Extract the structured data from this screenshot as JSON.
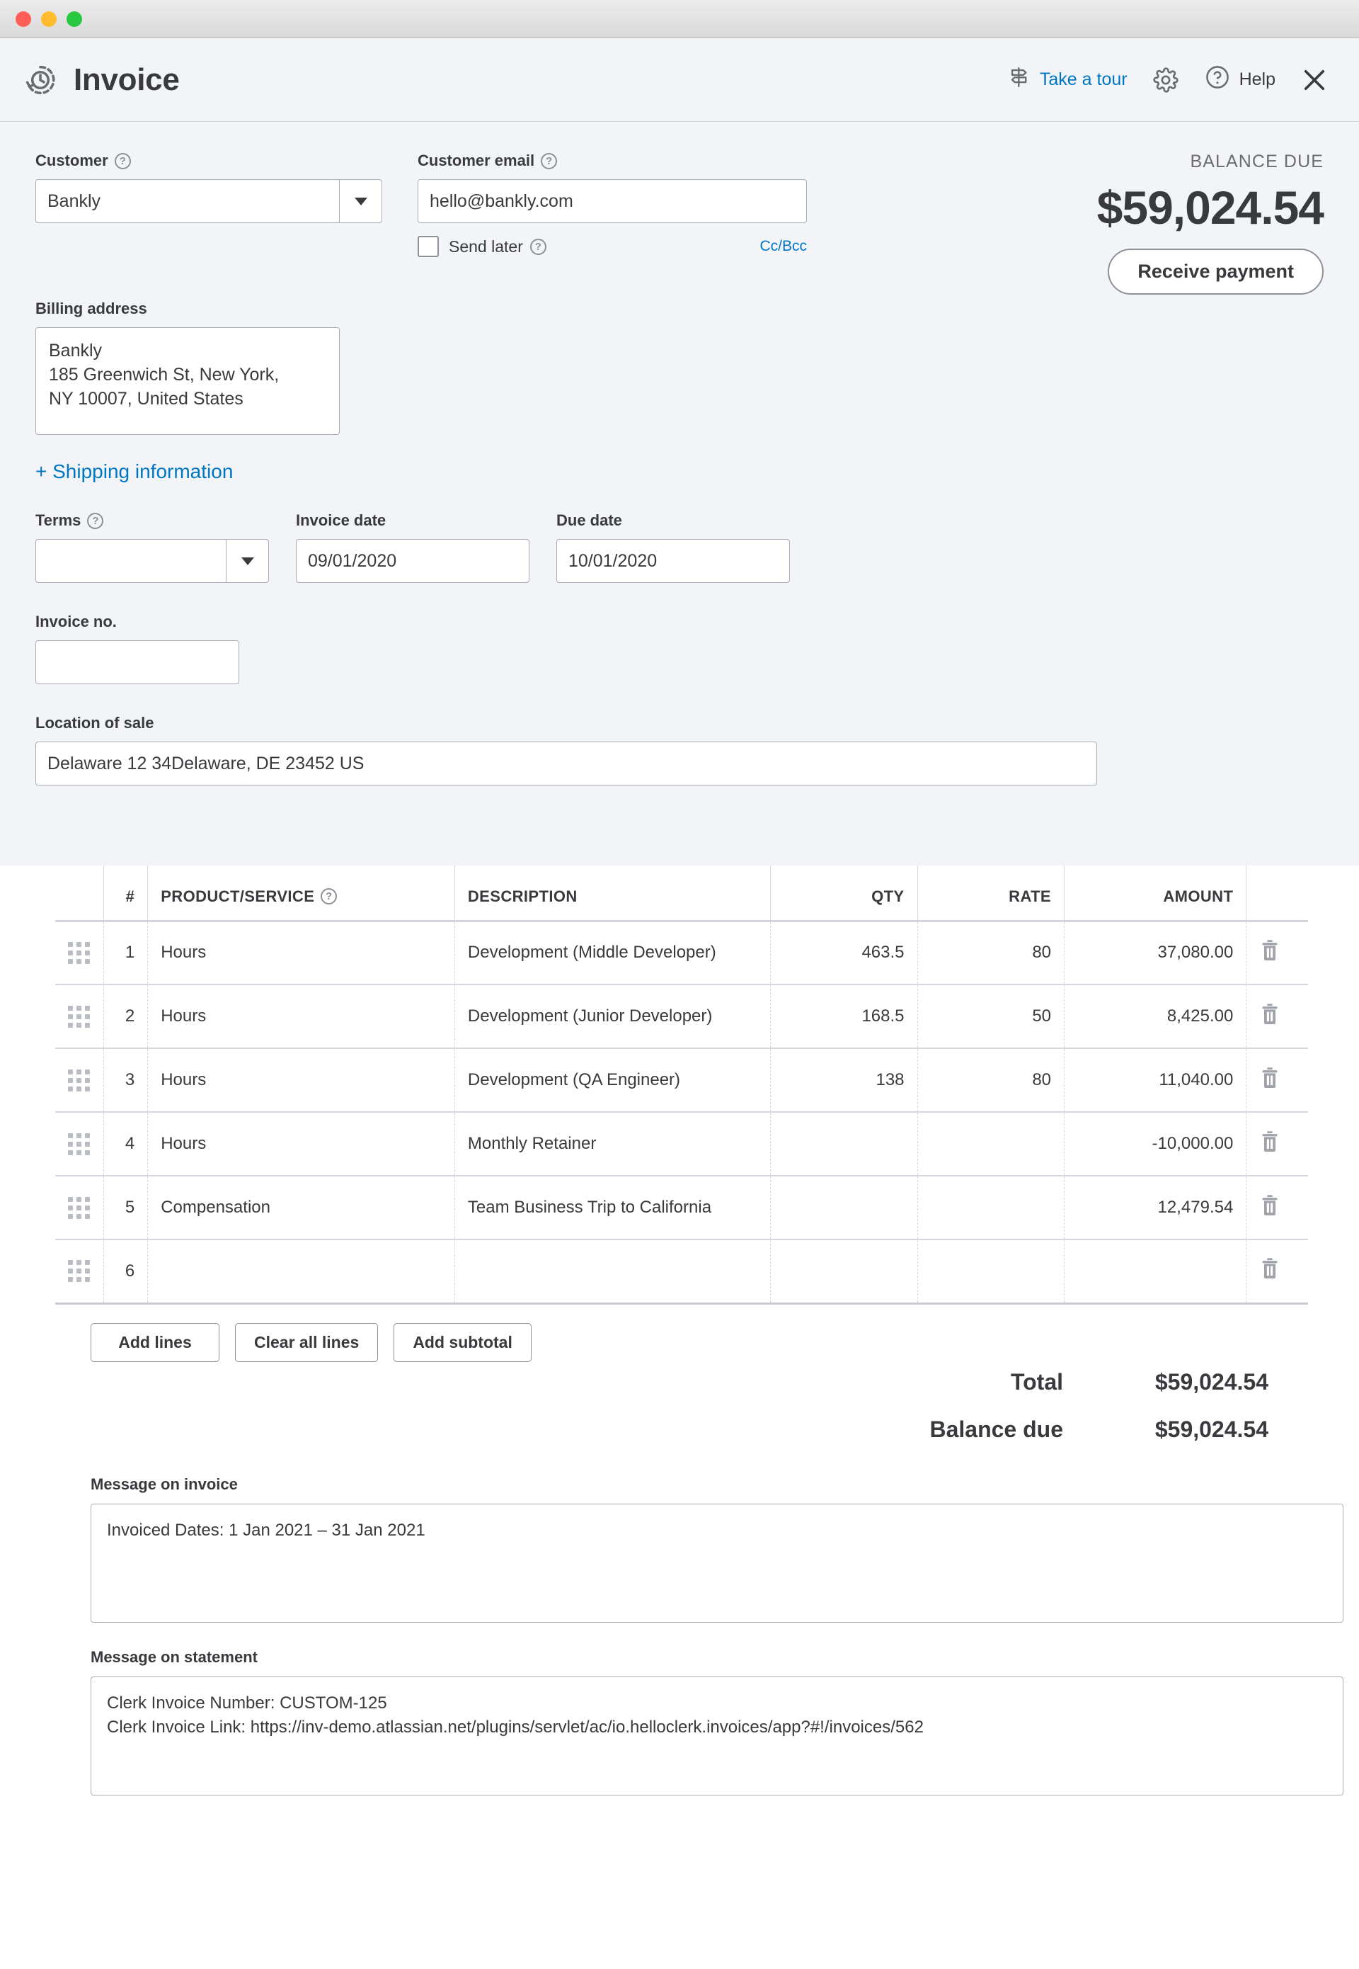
{
  "window": {
    "traffic_lights": [
      "close",
      "minimize",
      "maximize"
    ]
  },
  "header": {
    "title": "Invoice",
    "clock_icon": "history-clock-icon",
    "tour_label": "Take a tour",
    "tour_icon": "signpost-icon",
    "settings_icon": "gear-icon",
    "help_label": "Help",
    "help_icon": "question-circle-icon",
    "close_icon": "close-icon"
  },
  "form": {
    "customer_label": "Customer",
    "customer_value": "Bankly",
    "customer_email_label": "Customer email",
    "customer_email_value": "hello@bankly.com",
    "send_later_label": "Send later",
    "ccbcc_label": "Cc/Bcc",
    "billing_address_label": "Billing address",
    "billing_address_value": "Bankly\n185 Greenwich St, New York,\nNY 10007, United States",
    "shipping_link": "+ Shipping information",
    "terms_label": "Terms",
    "terms_value": "",
    "invoice_date_label": "Invoice date",
    "invoice_date_value": "09/01/2020",
    "due_date_label": "Due date",
    "due_date_value": "10/01/2020",
    "invoice_no_label": "Invoice no.",
    "invoice_no_value": "",
    "location_label": "Location of sale",
    "location_value": "Delaware 12 34Delaware, DE  23452 US"
  },
  "balance": {
    "label": "BALANCE DUE",
    "amount": "$59,024.54",
    "receive_payment_label": "Receive payment"
  },
  "line_items": {
    "headers": {
      "num": "#",
      "product": "PRODUCT/SERVICE",
      "description": "DESCRIPTION",
      "qty": "QTY",
      "rate": "RATE",
      "amount": "AMOUNT"
    },
    "rows": [
      {
        "num": "1",
        "product": "Hours",
        "description": "Development (Middle Developer)",
        "qty": "463.5",
        "rate": "80",
        "amount": "37,080.00"
      },
      {
        "num": "2",
        "product": "Hours",
        "description": "Development (Junior Developer)",
        "qty": "168.5",
        "rate": "50",
        "amount": "8,425.00"
      },
      {
        "num": "3",
        "product": "Hours",
        "description": "Development (QA Engineer)",
        "qty": "138",
        "rate": "80",
        "amount": "11,040.00"
      },
      {
        "num": "4",
        "product": "Hours",
        "description": "Monthly Retainer",
        "qty": "",
        "rate": "",
        "amount": "-10,000.00"
      },
      {
        "num": "5",
        "product": "Compensation",
        "description": "Team Business Trip to California",
        "qty": "",
        "rate": "",
        "amount": "12,479.54"
      },
      {
        "num": "6",
        "product": "",
        "description": "",
        "qty": "",
        "rate": "",
        "amount": ""
      }
    ],
    "drag_icon": "drag-handle-icon",
    "delete_icon": "trash-icon"
  },
  "actions": {
    "add_lines": "Add lines",
    "clear_all_lines": "Clear all lines",
    "add_subtotal": "Add subtotal"
  },
  "totals": {
    "total_label": "Total",
    "total_value": "$59,024.54",
    "balance_label": "Balance due",
    "balance_value": "$59,024.54"
  },
  "messages": {
    "invoice_label": "Message on invoice",
    "invoice_value": "Invoiced Dates: 1 Jan 2021 – 31 Jan 2021",
    "statement_label": "Message on statement",
    "statement_value": "Clerk Invoice Number: CUSTOM-125\nClerk Invoice Link: https://inv-demo.atlassian.net/plugins/servlet/ac/io.helloclerk.invoices/app?#!/invoices/562"
  },
  "colors": {
    "accent_link": "#0077c5",
    "panel_bg": "#f3f4f7",
    "text": "#393a3d"
  }
}
